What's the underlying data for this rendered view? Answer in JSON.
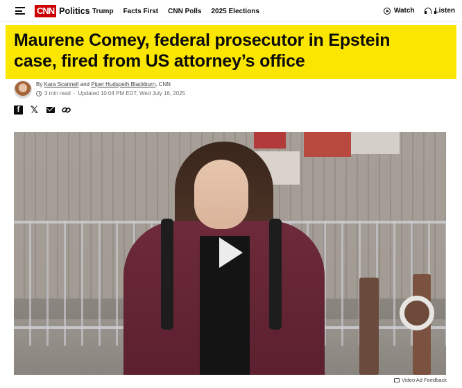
{
  "nav": {
    "logo_text": "CNN",
    "section": "Politics",
    "links": [
      "Trump",
      "Facts First",
      "CNN Polls",
      "2025 Elections"
    ],
    "watch_label": "Watch",
    "listen_label": "Listen"
  },
  "article": {
    "headline": "Maurene Comey, federal prosecutor in Epstein case, fired from US attorney’s office",
    "byline_prefix": "By",
    "author1": "Kara Scannell",
    "byline_and": "and",
    "author2": "Piper Hudspeth Blackburn",
    "byline_suffix": ", CNN",
    "read_time": "3 min read",
    "separator": "·",
    "updated": "Updated 10:04 PM EDT, Wed July 16, 2025"
  },
  "share": {
    "icons": [
      "facebook-icon",
      "x-icon",
      "email-icon",
      "link-icon"
    ]
  },
  "video": {
    "play_icon": "play-icon"
  },
  "ad_feedback": "Video Ad Feedback",
  "colors": {
    "brand_red": "#cc0000",
    "headline_yellow": "#fbe600",
    "text": "#0c0c0c"
  }
}
